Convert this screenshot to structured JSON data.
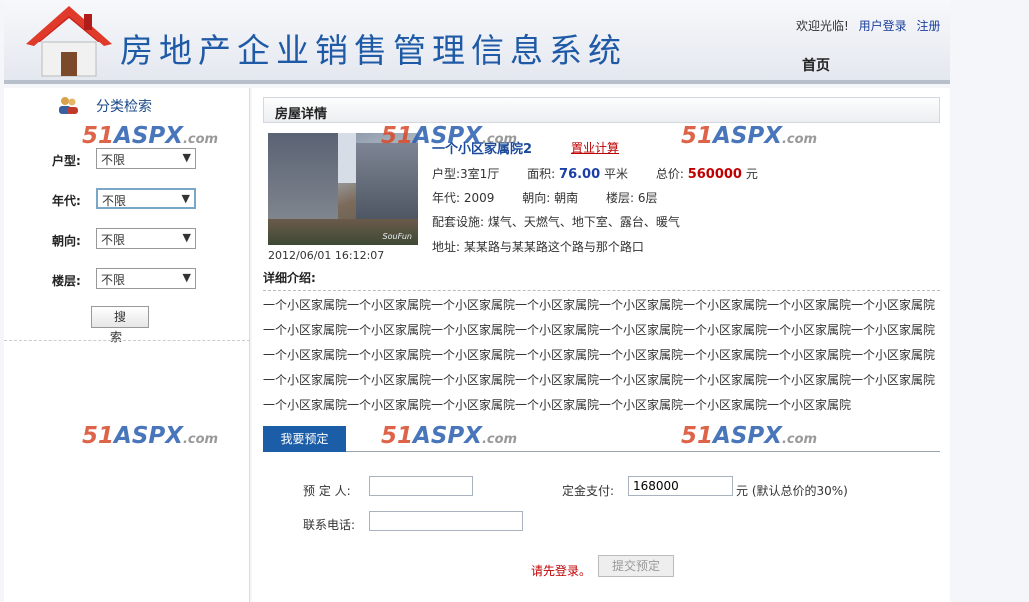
{
  "header": {
    "title": "房地产企业销售管理信息系统",
    "welcome": "欢迎光临!",
    "login_link": "用户登录",
    "register_link": "注册",
    "home_link": "首页"
  },
  "sidebar": {
    "title": "分类检索",
    "filters": [
      {
        "label": "户型:",
        "value": "不限"
      },
      {
        "label": "年代:",
        "value": "不限"
      },
      {
        "label": "朝向:",
        "value": "不限"
      },
      {
        "label": "楼层:",
        "value": "不限"
      }
    ],
    "search_button": "搜 索"
  },
  "main": {
    "section_title": "房屋详情",
    "house": {
      "name": "一个小区家属院2",
      "calc_link": "置业计算",
      "photo_date": "2012/06/01 16:12:07",
      "photo_watermark": "SouFun",
      "layout_label": "户型:",
      "layout_value": "3室1厅",
      "area_label": "面积:",
      "area_value": "76.00",
      "area_unit": "平米",
      "price_label": "总价:",
      "price_value": "560000",
      "price_unit": "元",
      "year_label": "年代:",
      "year_value": "2009",
      "orient_label": "朝向:",
      "orient_value": "朝南",
      "floor_label": "楼层:",
      "floor_value": "6层",
      "facility_label": "配套设施:",
      "facility_value": "煤气、天燃气、地下室、露台、暖气",
      "address_label": "地址:",
      "address_value": "某某路与某某路这个路与那个路口"
    },
    "detail_title": "详细介绍:",
    "detail_text": "一个小区家属院一个小区家属院一个小区家属院一个小区家属院一个小区家属院一个小区家属院一个小区家属院一个小区家属院一个小区家属院一个小区家属院一个小区家属院一个小区家属院一个小区家属院一个小区家属院一个小区家属院一个小区家属院一个小区家属院一个小区家属院一个小区家属院一个小区家属院一个小区家属院一个小区家属院一个小区家属院一个小区家属院一个小区家属院一个小区家属院一个小区家属院一个小区家属院一个小区家属院一个小区家属院一个小区家属院一个小区家属院一个小区家属院一个小区家属院一个小区家属院一个小区家属院一个小区家属院一个小区家属院一个小区家属院",
    "booking_tab": "我要预定",
    "form": {
      "booker_label": "预 定 人:",
      "booker_value": "",
      "deposit_label": "定金支付:",
      "deposit_value": "168000",
      "deposit_note": "元 (默认总价的30%)",
      "phone_label": "联系电话:",
      "phone_value": "",
      "login_tip": "请先登录。",
      "submit_button": "提交预定"
    }
  },
  "watermark": {
    "part1": "51",
    "part2": "ASPX",
    "part3": ".com"
  },
  "colors": {
    "brand_blue": "#1f5aa6",
    "tab_blue": "#1c5da8",
    "alert_red": "#c00000"
  }
}
